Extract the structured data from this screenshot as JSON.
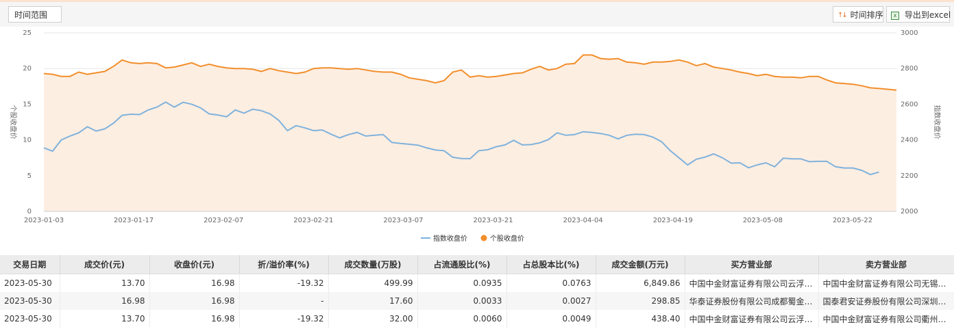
{
  "toolbar": {
    "range_label": "时间范围",
    "sort_label": "时间排序",
    "export_label": "导出到excel"
  },
  "colors": {
    "stock": "#f28e2b",
    "index": "#7fb2dc",
    "area": "#fdeee2"
  },
  "chart_data": {
    "type": "line",
    "xlabel": "",
    "ylabel": "个股收盘价",
    "y2label": "指数收盘价",
    "ylim": [
      0,
      25
    ],
    "y2lim": [
      2000,
      3000
    ],
    "yticks": [
      0,
      5,
      10,
      15,
      20,
      25
    ],
    "y2ticks": [
      2000,
      2200,
      2400,
      2600,
      2800,
      3000
    ],
    "xticks": [
      "2023-01-03",
      "2023-01-17",
      "2023-02-07",
      "2023-02-21",
      "2023-03-07",
      "2023-03-21",
      "2023-04-04",
      "2023-04-19",
      "2023-05-08",
      "2023-05-22"
    ],
    "legend_position": "bottom",
    "grid": true,
    "series": [
      {
        "name": "指数收盘价",
        "axis": "right",
        "values": [
          2356,
          2337,
          2400,
          2422,
          2440,
          2474,
          2450,
          2462,
          2494,
          2538,
          2544,
          2542,
          2568,
          2584,
          2612,
          2584,
          2611,
          2600,
          2580,
          2546,
          2540,
          2530,
          2568,
          2550,
          2572,
          2564,
          2546,
          2510,
          2452,
          2480,
          2468,
          2452,
          2456,
          2432,
          2412,
          2430,
          2442,
          2422,
          2426,
          2430,
          2386,
          2380,
          2376,
          2371,
          2356,
          2344,
          2340,
          2303,
          2296,
          2295,
          2340,
          2345,
          2362,
          2372,
          2398,
          2372,
          2374,
          2384,
          2402,
          2440,
          2426,
          2430,
          2446,
          2442,
          2436,
          2426,
          2406,
          2426,
          2432,
          2430,
          2416,
          2390,
          2340,
          2300,
          2260,
          2292,
          2304,
          2322,
          2300,
          2270,
          2272,
          2244,
          2260,
          2272,
          2250,
          2298,
          2294,
          2294,
          2278,
          2280,
          2280,
          2250,
          2243,
          2243,
          2230,
          2206,
          2220
        ]
      },
      {
        "name": "个股收盘价",
        "axis": "left",
        "values": [
          19.3,
          19.2,
          18.9,
          18.9,
          19.5,
          19.2,
          19.4,
          19.6,
          20.3,
          21.2,
          20.8,
          20.7,
          20.8,
          20.7,
          20.1,
          20.2,
          20.5,
          20.8,
          20.3,
          20.6,
          20.3,
          20.1,
          20.0,
          20.0,
          19.9,
          19.6,
          20.0,
          19.7,
          19.5,
          19.3,
          19.5,
          20.0,
          20.1,
          20.1,
          20.0,
          19.9,
          20.0,
          19.8,
          19.6,
          19.5,
          19.5,
          19.2,
          18.7,
          18.5,
          18.3,
          18.0,
          18.3,
          19.5,
          19.8,
          18.8,
          19.0,
          18.8,
          18.9,
          19.1,
          19.3,
          19.4,
          19.9,
          20.3,
          19.8,
          20.0,
          20.6,
          20.7,
          21.9,
          21.9,
          21.4,
          21.3,
          21.4,
          20.9,
          20.8,
          20.6,
          20.9,
          20.9,
          21.0,
          21.2,
          20.9,
          20.4,
          20.7,
          20.2,
          20.0,
          19.8,
          19.5,
          19.3,
          19.0,
          19.2,
          18.9,
          18.8,
          18.8,
          18.7,
          18.9,
          18.9,
          18.4,
          18.0,
          17.9,
          17.8,
          17.6,
          17.3,
          17.2,
          17.1,
          16.98
        ]
      }
    ]
  },
  "table": {
    "headers": [
      "交易日期",
      "成交价(元)",
      "收盘价(元)",
      "折/溢价率(%)",
      "成交数量(万股)",
      "占流通股比(%)",
      "占总股本比(%)",
      "成交金额(万元)",
      "买方营业部",
      "卖方营业部"
    ],
    "rows": [
      [
        "2023-05-30",
        "13.70",
        "16.98",
        "-19.32",
        "499.99",
        "0.0935",
        "0.0763",
        "6,849.86",
        "中国中金财富证券有限公司云浮…",
        "中国中金财富证券有限公司无锡…"
      ],
      [
        "2023-05-30",
        "16.98",
        "16.98",
        "-",
        "17.60",
        "0.0033",
        "0.0027",
        "298.85",
        "华泰证券股份有限公司成都蜀金…",
        "国泰君安证券股份有限公司深圳…"
      ],
      [
        "2023-05-30",
        "13.70",
        "16.98",
        "-19.32",
        "32.00",
        "0.0060",
        "0.0049",
        "438.40",
        "中国中金财富证券有限公司云浮…",
        "中国中金财富证券有限公司衢州…"
      ]
    ]
  }
}
